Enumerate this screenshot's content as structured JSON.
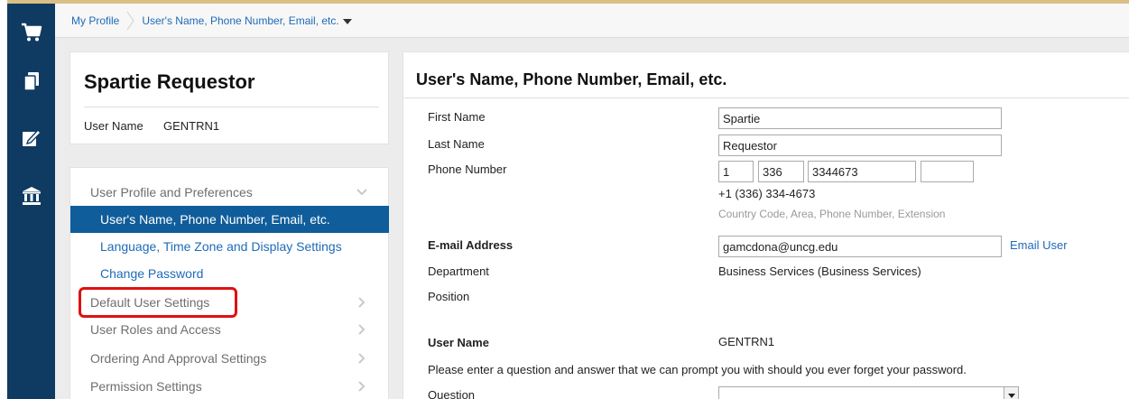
{
  "breadcrumb": {
    "home_label": "My Profile",
    "current_label": "User's Name, Phone Number, Email, etc."
  },
  "nav": {
    "icons": [
      "shopping-cart-icon",
      "documents-icon",
      "edit-form-icon",
      "bank-icon"
    ]
  },
  "profile": {
    "name": "Spartie Requestor",
    "user_name_label": "User Name",
    "user_name_value": "GENTRN1"
  },
  "menu": {
    "sections": [
      {
        "label": "User Profile and Preferences",
        "expanded": true,
        "items": [
          {
            "label": "User's Name, Phone Number, Email, etc.",
            "active": true
          },
          {
            "label": "Language, Time Zone and Display Settings",
            "active": false
          },
          {
            "label": "Change Password",
            "active": false
          }
        ]
      },
      {
        "label": "Default User Settings",
        "expanded": false,
        "highlighted": true
      },
      {
        "label": "User Roles and Access",
        "expanded": false
      },
      {
        "label": "Ordering And Approval Settings",
        "expanded": false
      },
      {
        "label": "Permission Settings",
        "expanded": false
      }
    ]
  },
  "form": {
    "title": "User's Name, Phone Number, Email, etc.",
    "first_name_label": "First Name",
    "first_name_value": "Spartie",
    "last_name_label": "Last Name",
    "last_name_value": "Requestor",
    "phone_label": "Phone Number",
    "phone_country": "1",
    "phone_area": "336",
    "phone_number": "3344673",
    "phone_extension": "",
    "phone_formatted": "+1 (336) 334-4673",
    "phone_hint": "Country Code, Area, Phone Number, Extension",
    "email_label": "E-mail Address",
    "email_value": "gamcdona@uncg.edu",
    "email_user_link": "Email User",
    "department_label": "Department",
    "department_value": "Business Services (Business Services)",
    "position_label": "Position",
    "user_name_label": "User Name",
    "user_name_value": "GENTRN1",
    "security_prompt": "Please enter a question and answer that we can prompt you with should you ever forget your password.",
    "question_label": "Question",
    "question_value": ""
  },
  "colors": {
    "nav_bg": "#0f3a62",
    "active_item_bg": "#0f5d9b",
    "link": "#1e6bb8",
    "highlight_box": "#e01010",
    "top_accent": "#d9bf86"
  }
}
